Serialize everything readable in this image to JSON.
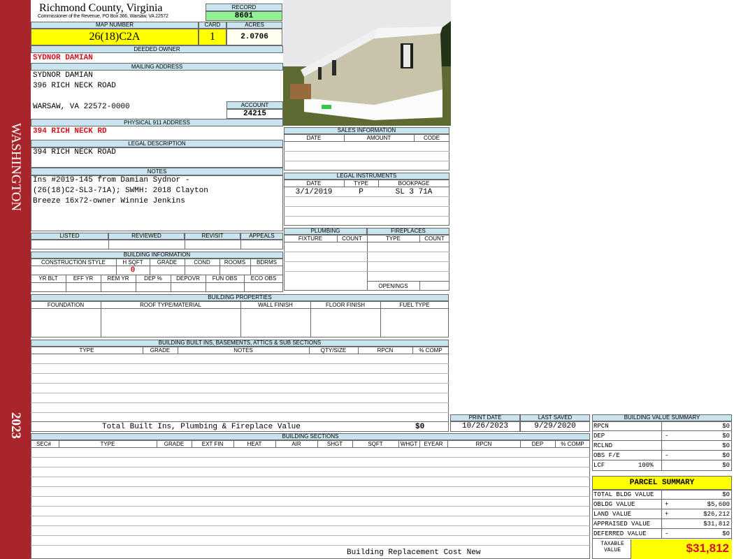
{
  "sidebar": {
    "locality": "WASHINGTON",
    "year": "2023"
  },
  "header": {
    "county": "Richmond County, Virginia",
    "commissioner": "Commissioner of the Revenue, PO Box 366, Warsaw, VA 22572"
  },
  "record": {
    "label": "RECORD",
    "value": "8601"
  },
  "map_number": {
    "label": "MAP NUMBER",
    "value": "26(18)C2A"
  },
  "card": {
    "label": "CARD",
    "value": "1"
  },
  "acres": {
    "label": "ACRES",
    "value": "2.0706"
  },
  "deeded_owner": {
    "label": "DEEDED OWNER",
    "value": "SYDNOR DAMIAN"
  },
  "mailing": {
    "label": "MAILING ADDRESS",
    "line1": "SYDNOR DAMIAN",
    "line2": "396 RICH NECK ROAD",
    "line3": "WARSAW, VA 22572-0000"
  },
  "account": {
    "label": "ACCOUNT",
    "value": "24215"
  },
  "physical": {
    "label": "PHYSICAL 911 ADDRESS",
    "value": "394 RICH NECK RD"
  },
  "legal": {
    "label": "LEGAL DESCRIPTION",
    "value": "394 RICH NECK ROAD"
  },
  "notes": {
    "label": "NOTES",
    "line1": "Ins #2019-145 from Damian Sydnor -",
    "line2": "(26(18)C2-SL3-71A); SWMH: 2018 Clayton",
    "line3": "Breeze 16x72-owner Winnie Jenkins"
  },
  "status": {
    "listed": "LISTED",
    "reviewed": "REVIEWED",
    "revisit": "REVISIT",
    "appeals": "APPEALS"
  },
  "building_info": {
    "label": "BUILDING INFORMATION",
    "construction_style": "CONSTRUCTION STYLE",
    "h_sqft": "H SQFT",
    "grade": "GRADE",
    "cond": "COND",
    "rooms": "ROOMS",
    "bdrms": "BDRMS",
    "h_sqft_value": "0",
    "yr_blt": "YR BLT",
    "eff_yr": "EFF YR",
    "rem_yr": "REM YR",
    "dep_pct": "DEP %",
    "depovr": "DEPOVR",
    "fun_obs": "FUN OBS",
    "eco_obs": "ECO OBS"
  },
  "sales": {
    "label": "SALES INFORMATION",
    "date": "DATE",
    "amount": "AMOUNT",
    "code": "CODE"
  },
  "legal_instruments": {
    "label": "LEGAL INSTRUMENTS",
    "date": "DATE",
    "type": "TYPE",
    "bookpage": "BOOKPAGE",
    "row1": {
      "date": "3/1/2019",
      "type": "P",
      "bookpage": "SL 3 71A"
    }
  },
  "plumbing": {
    "label": "PLUMBING",
    "fixture": "FIXTURE",
    "count": "COUNT"
  },
  "fireplaces": {
    "label": "FIREPLACES",
    "type": "TYPE",
    "count": "COUNT",
    "openings": "OPENINGS"
  },
  "building_properties": {
    "label": "BUILDING PROPERTIES",
    "foundation": "FOUNDATION",
    "roof": "ROOF TYPE/MATERIAL",
    "wall": "WALL FINISH",
    "floor": "FLOOR FINISH",
    "fuel": "FUEL TYPE"
  },
  "builtins": {
    "label": "BUILDING BUILT INS, BASEMENTS, ATTICS & SUB SECTIONS",
    "type": "TYPE",
    "grade": "GRADE",
    "notes": "NOTES",
    "qty": "QTY/SIZE",
    "rpcn": "RPCN",
    "comp": "% COMP",
    "total_label": "Total Built Ins, Plumbing & Fireplace Value",
    "total_value": "$0"
  },
  "print": {
    "print_date_label": "PRINT DATE",
    "print_date": "10/26/2023",
    "last_saved_label": "LAST SAVED",
    "last_saved": "9/29/2020"
  },
  "sections": {
    "label": "BUILDING SECTIONS",
    "sec": "SEC#",
    "type": "TYPE",
    "grade": "GRADE",
    "ext_fin": "EXT FIN",
    "heat": "HEAT",
    "air": "AIR",
    "shgt": "SHGT",
    "sqft": "SQFT",
    "whgt": "WHGT",
    "eyear": "EYEAR",
    "rpcn": "RPCN",
    "dep": "DEP",
    "comp": "% COMP",
    "footer": "Building Replacement Cost New"
  },
  "value_summary": {
    "label": "BUILDING VALUE SUMMARY",
    "rpcn": {
      "label": "RPCN",
      "sign": "",
      "value": "$0"
    },
    "dep": {
      "label": "DEP",
      "sign": "-",
      "value": "$0"
    },
    "rclnd": {
      "label": "RCLND",
      "sign": "",
      "value": "$0"
    },
    "obs": {
      "label": "OBS F/E",
      "sign": "-",
      "value": "$0"
    },
    "lcf": {
      "label": "LCF",
      "pct": "100%",
      "value": "$0"
    }
  },
  "parcel": {
    "label": "PARCEL SUMMARY",
    "total_bldg": {
      "label": "TOTAL BLDG VALUE",
      "sign": "",
      "value": "$0"
    },
    "obldg": {
      "label": "OBLDG VALUE",
      "sign": "+",
      "value": "$5,600"
    },
    "land": {
      "label": "LAND VALUE",
      "sign": "+",
      "value": "$26,212"
    },
    "appraised": {
      "label": "APPRAISED VALUE",
      "sign": "",
      "value": "$31,812"
    },
    "deferred": {
      "label": "DEFERRED VALUE",
      "sign": "-",
      "value": "$0"
    },
    "taxable_label_1": "TAXABLE",
    "taxable_label_2": "VALUE",
    "taxable_value": "$31,812"
  },
  "colors": {
    "sidebar": "#a8262b",
    "header_band": "#c8e4ee",
    "highlight": "#ffff00",
    "record_green": "#93f195",
    "accent_red": "#d1131d"
  }
}
